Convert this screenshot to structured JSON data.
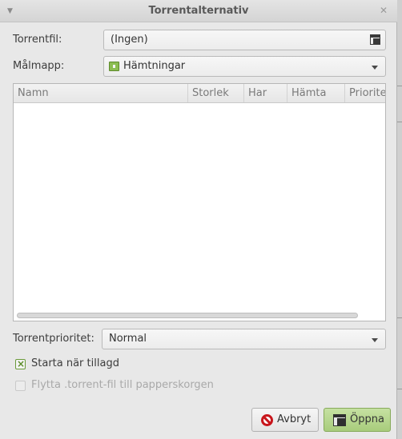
{
  "window": {
    "title": "Torrentalternativ"
  },
  "torrent_file": {
    "label": "Torrentfil:",
    "value": "(Ingen)"
  },
  "destination": {
    "label": "Målmapp:",
    "value": "Hämtningar"
  },
  "file_list": {
    "columns": [
      "Namn",
      "Storlek",
      "Har",
      "Hämta",
      "Priorite"
    ],
    "rows": []
  },
  "priority": {
    "label": "Torrentprioritet:",
    "value": "Normal"
  },
  "start_when_added": {
    "label": "Starta när tillagd",
    "checked": true
  },
  "trash_torrent_file": {
    "label": "Flytta .torrent-fil till papperskorgen",
    "checked": false,
    "enabled": false
  },
  "buttons": {
    "cancel": "Avbryt",
    "open": "Öppna"
  },
  "colors": {
    "accent": "#a8cc7c",
    "cancel_icon": "#c8161c",
    "folder_icon": "#8cbd52"
  }
}
